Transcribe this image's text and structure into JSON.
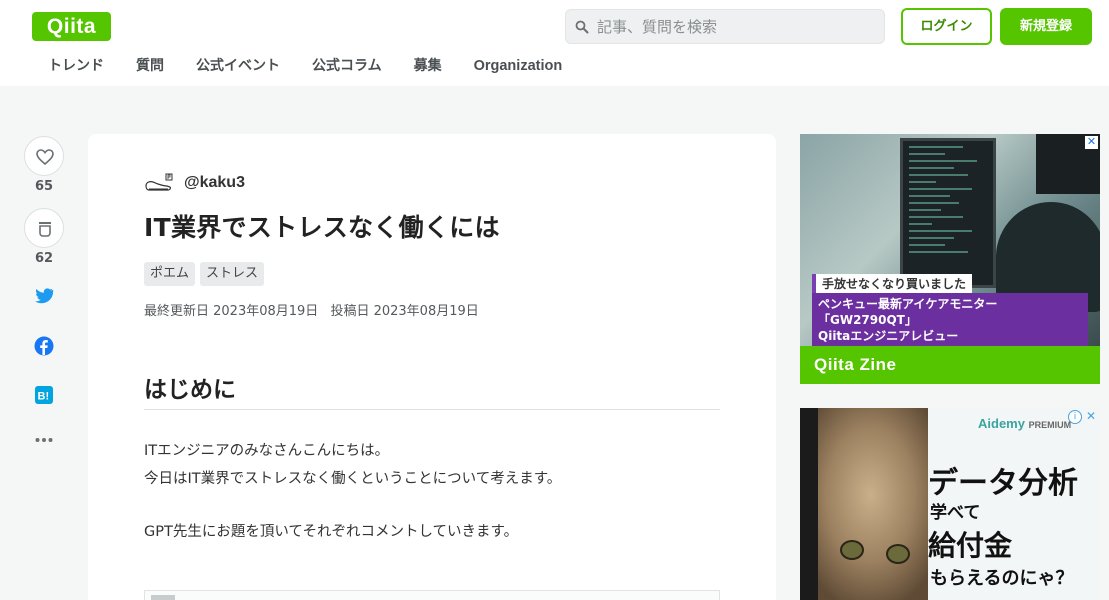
{
  "header": {
    "logo": "Qiita",
    "search_placeholder": "記事、質問を検索",
    "login_label": "ログイン",
    "signup_label": "新規登録",
    "nav": [
      "トレンド",
      "質問",
      "公式イベント",
      "公式コラム",
      "募集",
      "Organization"
    ]
  },
  "actions": {
    "like_count": "65",
    "stock_count": "62",
    "share_icons": [
      "twitter-icon",
      "facebook-icon",
      "hatena-bookmark-icon",
      "more-icon"
    ]
  },
  "article": {
    "author": "@kaku3",
    "title": "IT業界でストレスなく働くには",
    "tags": [
      "ポエム",
      "ストレス"
    ],
    "updated": "最終更新日 2023年08月19日",
    "posted": "投稿日 2023年08月19日",
    "heading": "はじめに",
    "paragraphs": [
      "ITエンジニアのみなさんこんにちは。",
      "今日はIT業界でストレスなく働くということについて考えます。",
      "GPT先生にお題を頂いてそれぞれコメントしていきます。"
    ]
  },
  "ads": {
    "ad1": {
      "catch": "手放せなくなり買いました",
      "caption_line1": "ペンキュー最新アイケアモニター「GW2790QT」",
      "caption_line2": "Qiitaエンジニアレビュー",
      "brand": "Qiita Zine"
    },
    "ad2": {
      "brand": "Aidemy",
      "brand_sub": "PREMIUM",
      "line1": "データ分析",
      "line2": "学べて",
      "line3": "給付金",
      "line4": "もらえるのにゃ？"
    }
  },
  "colors": {
    "brand_green": "#55c500",
    "ad_purple": "#6c2fa0"
  }
}
